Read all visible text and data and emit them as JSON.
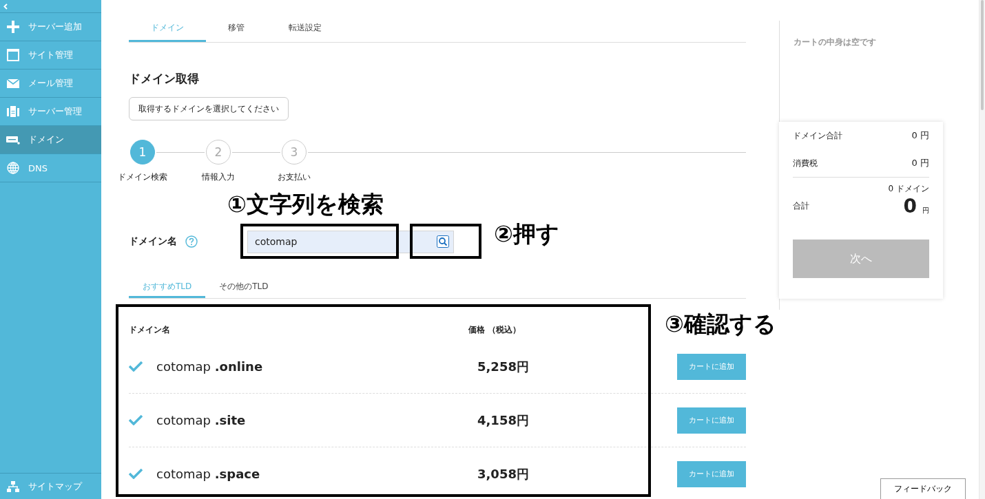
{
  "sidebar": {
    "items": [
      {
        "label": "サーバー追加",
        "kind": "plus",
        "selected": false
      },
      {
        "label": "サイト管理",
        "kind": "window",
        "selected": false
      },
      {
        "label": "メール管理",
        "kind": "mail",
        "selected": false
      },
      {
        "label": "サーバー管理",
        "kind": "server",
        "selected": false
      },
      {
        "label": "ドメイン",
        "kind": "domain",
        "selected": true
      },
      {
        "label": "DNS",
        "kind": "globe",
        "selected": false
      }
    ],
    "footer": {
      "label": "サイトマップ"
    }
  },
  "tabs": [
    {
      "label": "ドメイン",
      "selected": true
    },
    {
      "label": "移管",
      "selected": false
    },
    {
      "label": "転送設定",
      "selected": false
    }
  ],
  "heading": "ドメイン取得",
  "tooltip": "取得するドメインを選択してください",
  "steps": [
    {
      "number": "1",
      "label": "ドメイン検索",
      "selected": true
    },
    {
      "number": "2",
      "label": "情報入力",
      "selected": false
    },
    {
      "number": "3",
      "label": "お支払い",
      "selected": false
    }
  ],
  "domain_field": {
    "label": "ドメイン名",
    "value": "cotomap"
  },
  "tld_tabs": [
    {
      "label": "おすすめTLD",
      "selected": true
    },
    {
      "label": "その他のTLD",
      "selected": false
    }
  ],
  "table": {
    "columns": [
      "ドメイン名",
      "価格 （税込）"
    ],
    "rows": [
      {
        "name": "cotomap",
        "tld": ".online",
        "price": "5,258円",
        "checked": true,
        "button": "カートに追加"
      },
      {
        "name": "cotomap",
        "tld": ".site",
        "price": "4,158円",
        "checked": true,
        "button": "カートに追加"
      },
      {
        "name": "cotomap",
        "tld": ".space",
        "price": "3,058円",
        "checked": true,
        "button": "カートに追加"
      }
    ]
  },
  "cart": {
    "empty_message": "カートの中身は空です",
    "lines": [
      {
        "label": "ドメイン合計",
        "value": "0 円"
      },
      {
        "label": "消費税",
        "value": "0 円"
      }
    ],
    "domain_count": "0 ドメイン",
    "total_label": "合計",
    "total_value": "0",
    "total_unit": "円",
    "next_button": {
      "label": "次へ",
      "disabled": true
    }
  },
  "feedback_button": "フィードバック",
  "annotations": [
    {
      "text": "①文字列を検索"
    },
    {
      "text": "②押す"
    },
    {
      "text": "③確認する"
    }
  ]
}
